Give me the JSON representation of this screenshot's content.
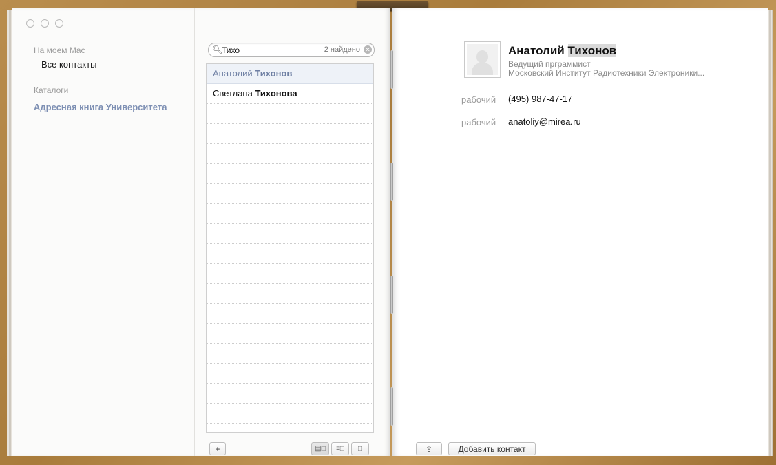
{
  "sidebar": {
    "section_on_mac": "На моем Mac",
    "all_contacts": "Все контакты",
    "section_directories": "Каталоги",
    "directory_university": "Адресная книга Университета"
  },
  "search": {
    "query": "Тихо",
    "results_count": "2 найдено"
  },
  "list": {
    "items": [
      {
        "first": "Анатолий",
        "last": "Тихонов",
        "selected": true
      },
      {
        "first": "Светлана",
        "last": "Тихонова",
        "selected": false
      }
    ]
  },
  "toolbar": {
    "add_label": "+",
    "share_label": "⇪",
    "add_contact_label": "Добавить контакт"
  },
  "card": {
    "first_name": "Анатолий",
    "last_name": "Тихонов",
    "job_title": "Ведущий прграммист",
    "organization": "Московский Институт Радиотехники Электроники...",
    "phone_label": "рабочий",
    "phone": "(495) 987-47-17",
    "email_label": "рабочий",
    "email": "anatoliy@mirea.ru"
  },
  "colors": {
    "selection_text": "#6e7fa3",
    "directory_link": "#7d8fb3",
    "leather": "#b98d4d"
  }
}
